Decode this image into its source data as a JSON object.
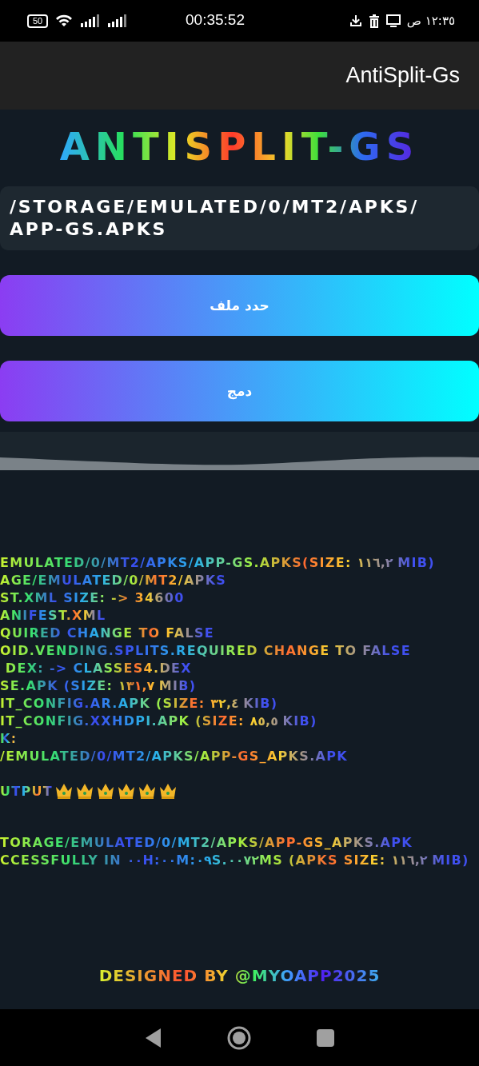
{
  "status_bar": {
    "battery": "50",
    "clock": "00:35:52",
    "time_local": "١٢:٣٥ ص"
  },
  "app_bar": {
    "title": "AntiSplit-Gs"
  },
  "logo": "ANTISPLIT-GS",
  "path_field": {
    "value": "/STORAGE/EMULATED/0/MT2/APKS/APP-GS.APKS"
  },
  "buttons": [
    "حدد ملف",
    "دمج"
  ],
  "log": [
    {
      "text": "EMULATED/0/MT2/APKS/APP-GS.APKS(SIZE: ١١٦,٢ MIB)",
      "kind": "line"
    },
    {
      "text": "AGE/EMULATED/0/MT2/APKS",
      "kind": "line"
    },
    {
      "text": "ST.XML SIZE: -> 34600",
      "kind": "line"
    },
    {
      "text": "ANIFEST.XML",
      "kind": "line"
    },
    {
      "text": "QUIRED CHANGE TO FALSE",
      "kind": "line"
    },
    {
      "text": "OID.VENDING.SPLITS.REQUIRED CHANGE TO FALSE",
      "kind": "line"
    },
    {
      "text": " DEX: -> CLASSES4.DEX",
      "kind": "line"
    },
    {
      "text": "SE.APK (SIZE: ١٣١,٧ MIB)",
      "kind": "line"
    },
    {
      "text": "IT_CONFIG.AR.APK (SIZE: ٣٢,٤ KIB)",
      "kind": "line"
    },
    {
      "text": "IT_CONFIG.XXHDPI.APK (SIZE: ٨٥,٥ KIB)",
      "kind": "line"
    },
    {
      "text": "K:",
      "kind": "line"
    },
    {
      "text": "/EMULATED/0/MT2/APKS/APP-GS_APKS.APK",
      "kind": "line"
    },
    {
      "text": "UTPUT",
      "kind": "spaced",
      "icons": [
        {
          "kind": "crown"
        },
        {
          "kind": "crown"
        },
        {
          "kind": "crown"
        },
        {
          "kind": "crown"
        },
        {
          "kind": "crown"
        },
        {
          "kind": "crown"
        }
      ]
    },
    {
      "text": "TORAGE/EMULATED/0/MT2/APKS/APP-GS_APKS.APK",
      "kind": "gap"
    },
    {
      "text": "CCESSFULLY IN ٠٠H:٠٠M:٠٩S.٠٠٧٢MS (APKS SIZE: ١١٦,٢ MIB)",
      "kind": "line"
    }
  ],
  "footer": "DESIGNED BY @MYOAPP2025"
}
